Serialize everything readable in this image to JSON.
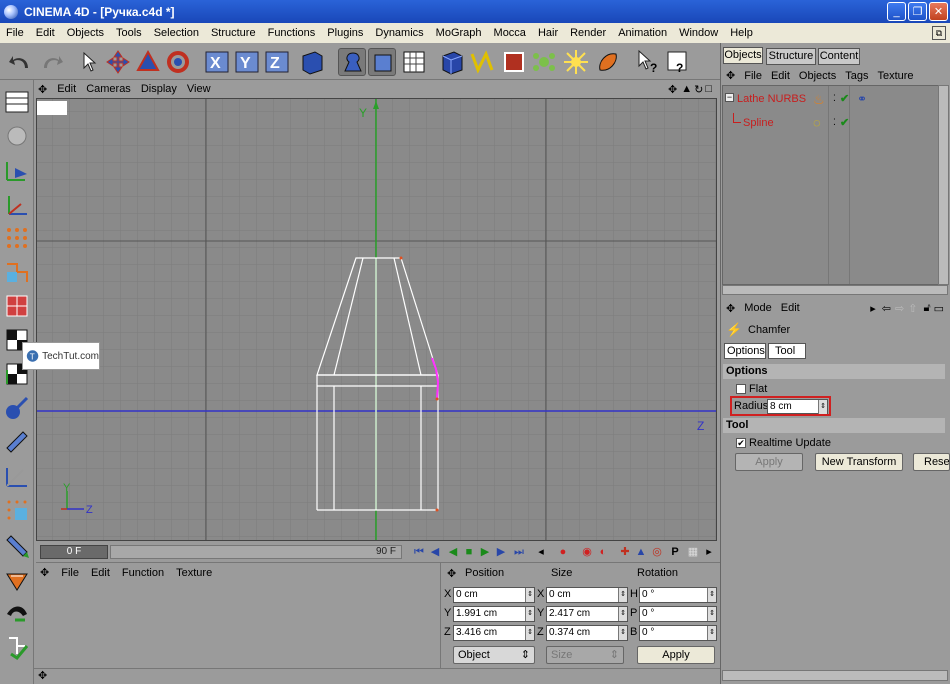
{
  "window": {
    "title": "CINEMA 4D - [Ручка.c4d *]",
    "controls": [
      "minimize-icon",
      "maximize-icon",
      "close-icon"
    ]
  },
  "menubar": {
    "items": [
      "File",
      "Edit",
      "Objects",
      "Tools",
      "Selection",
      "Structure",
      "Functions",
      "Plugins",
      "Dynamics",
      "MoGraph",
      "Mocca",
      "Hair",
      "Render",
      "Animation",
      "Window",
      "Help"
    ]
  },
  "viewport": {
    "menu": [
      "Edit",
      "Cameras",
      "Display",
      "View"
    ],
    "axis_y": "Y",
    "axis_z": "Z",
    "mini_axis_y": "Y",
    "mini_axis_z": "Z",
    "grid_color": "#5a5a5a",
    "axis_y_color": "#2aa02a",
    "axis_z_color": "#3232c8"
  },
  "watermark": {
    "text": "TechTut.com"
  },
  "timeline": {
    "current_frame": "0 F",
    "end_frame": "90 F"
  },
  "material_manager": {
    "menu": [
      "File",
      "Edit",
      "Function",
      "Texture"
    ]
  },
  "coordinates": {
    "headers": [
      "Position",
      "Size",
      "Rotation"
    ],
    "rows": [
      {
        "pos_label": "X",
        "pos": "0 cm",
        "size_label": "X",
        "size": "0 cm",
        "rot_label": "H",
        "rot": "0 °"
      },
      {
        "pos_label": "Y",
        "pos": "1.991 cm",
        "size_label": "Y",
        "size": "2.417 cm",
        "rot_label": "P",
        "rot": "0 °"
      },
      {
        "pos_label": "Z",
        "pos": "3.416 cm",
        "size_label": "Z",
        "size": "0.374 cm",
        "rot_label": "B",
        "rot": "0 °"
      }
    ],
    "mode_select": "Object",
    "size_select": "Size",
    "apply_label": "Apply"
  },
  "object_manager": {
    "tabs": [
      "Objects",
      "Structure",
      "Content"
    ],
    "menu": [
      "File",
      "Edit",
      "Objects",
      "Tags",
      "Texture"
    ],
    "objects": [
      {
        "name": "Lathe NURBS",
        "color": "#c81e1e"
      },
      {
        "name": "Spline",
        "color": "#c81e1e"
      }
    ]
  },
  "attribute_manager": {
    "menu": [
      "Mode",
      "Edit"
    ],
    "tool_name": "Chamfer",
    "tabs": [
      "Options",
      "Tool"
    ],
    "options_header": "Options",
    "flat_label": "Flat",
    "radius_label": "Radius",
    "radius_value": "8 cm",
    "tool_header": "Tool",
    "realtime_label": "Realtime Update",
    "buttons": [
      "Apply",
      "New Transform",
      "Reset"
    ]
  }
}
